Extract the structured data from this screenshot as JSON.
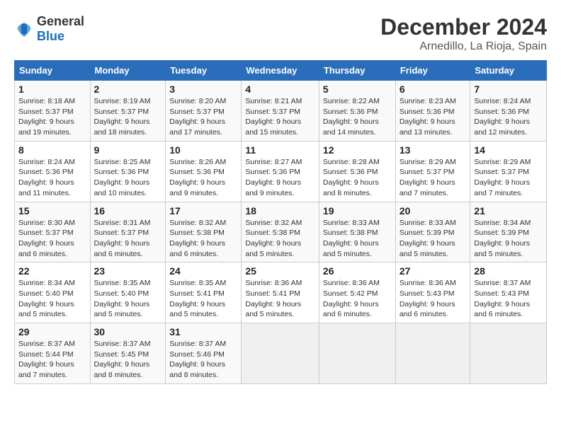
{
  "header": {
    "logo_general": "General",
    "logo_blue": "Blue",
    "month": "December 2024",
    "location": "Arnedillo, La Rioja, Spain"
  },
  "days_of_week": [
    "Sunday",
    "Monday",
    "Tuesday",
    "Wednesday",
    "Thursday",
    "Friday",
    "Saturday"
  ],
  "weeks": [
    [
      {
        "day": "1",
        "lines": [
          "Sunrise: 8:18 AM",
          "Sunset: 5:37 PM",
          "Daylight: 9 hours",
          "and 19 minutes."
        ]
      },
      {
        "day": "2",
        "lines": [
          "Sunrise: 8:19 AM",
          "Sunset: 5:37 PM",
          "Daylight: 9 hours",
          "and 18 minutes."
        ]
      },
      {
        "day": "3",
        "lines": [
          "Sunrise: 8:20 AM",
          "Sunset: 5:37 PM",
          "Daylight: 9 hours",
          "and 17 minutes."
        ]
      },
      {
        "day": "4",
        "lines": [
          "Sunrise: 8:21 AM",
          "Sunset: 5:37 PM",
          "Daylight: 9 hours",
          "and 15 minutes."
        ]
      },
      {
        "day": "5",
        "lines": [
          "Sunrise: 8:22 AM",
          "Sunset: 5:36 PM",
          "Daylight: 9 hours",
          "and 14 minutes."
        ]
      },
      {
        "day": "6",
        "lines": [
          "Sunrise: 8:23 AM",
          "Sunset: 5:36 PM",
          "Daylight: 9 hours",
          "and 13 minutes."
        ]
      },
      {
        "day": "7",
        "lines": [
          "Sunrise: 8:24 AM",
          "Sunset: 5:36 PM",
          "Daylight: 9 hours",
          "and 12 minutes."
        ]
      }
    ],
    [
      {
        "day": "8",
        "lines": [
          "Sunrise: 8:24 AM",
          "Sunset: 5:36 PM",
          "Daylight: 9 hours",
          "and 11 minutes."
        ]
      },
      {
        "day": "9",
        "lines": [
          "Sunrise: 8:25 AM",
          "Sunset: 5:36 PM",
          "Daylight: 9 hours",
          "and 10 minutes."
        ]
      },
      {
        "day": "10",
        "lines": [
          "Sunrise: 8:26 AM",
          "Sunset: 5:36 PM",
          "Daylight: 9 hours",
          "and 9 minutes."
        ]
      },
      {
        "day": "11",
        "lines": [
          "Sunrise: 8:27 AM",
          "Sunset: 5:36 PM",
          "Daylight: 9 hours",
          "and 9 minutes."
        ]
      },
      {
        "day": "12",
        "lines": [
          "Sunrise: 8:28 AM",
          "Sunset: 5:36 PM",
          "Daylight: 9 hours",
          "and 8 minutes."
        ]
      },
      {
        "day": "13",
        "lines": [
          "Sunrise: 8:29 AM",
          "Sunset: 5:37 PM",
          "Daylight: 9 hours",
          "and 7 minutes."
        ]
      },
      {
        "day": "14",
        "lines": [
          "Sunrise: 8:29 AM",
          "Sunset: 5:37 PM",
          "Daylight: 9 hours",
          "and 7 minutes."
        ]
      }
    ],
    [
      {
        "day": "15",
        "lines": [
          "Sunrise: 8:30 AM",
          "Sunset: 5:37 PM",
          "Daylight: 9 hours",
          "and 6 minutes."
        ]
      },
      {
        "day": "16",
        "lines": [
          "Sunrise: 8:31 AM",
          "Sunset: 5:37 PM",
          "Daylight: 9 hours",
          "and 6 minutes."
        ]
      },
      {
        "day": "17",
        "lines": [
          "Sunrise: 8:32 AM",
          "Sunset: 5:38 PM",
          "Daylight: 9 hours",
          "and 6 minutes."
        ]
      },
      {
        "day": "18",
        "lines": [
          "Sunrise: 8:32 AM",
          "Sunset: 5:38 PM",
          "Daylight: 9 hours",
          "and 5 minutes."
        ]
      },
      {
        "day": "19",
        "lines": [
          "Sunrise: 8:33 AM",
          "Sunset: 5:38 PM",
          "Daylight: 9 hours",
          "and 5 minutes."
        ]
      },
      {
        "day": "20",
        "lines": [
          "Sunrise: 8:33 AM",
          "Sunset: 5:39 PM",
          "Daylight: 9 hours",
          "and 5 minutes."
        ]
      },
      {
        "day": "21",
        "lines": [
          "Sunrise: 8:34 AM",
          "Sunset: 5:39 PM",
          "Daylight: 9 hours",
          "and 5 minutes."
        ]
      }
    ],
    [
      {
        "day": "22",
        "lines": [
          "Sunrise: 8:34 AM",
          "Sunset: 5:40 PM",
          "Daylight: 9 hours",
          "and 5 minutes."
        ]
      },
      {
        "day": "23",
        "lines": [
          "Sunrise: 8:35 AM",
          "Sunset: 5:40 PM",
          "Daylight: 9 hours",
          "and 5 minutes."
        ]
      },
      {
        "day": "24",
        "lines": [
          "Sunrise: 8:35 AM",
          "Sunset: 5:41 PM",
          "Daylight: 9 hours",
          "and 5 minutes."
        ]
      },
      {
        "day": "25",
        "lines": [
          "Sunrise: 8:36 AM",
          "Sunset: 5:41 PM",
          "Daylight: 9 hours",
          "and 5 minutes."
        ]
      },
      {
        "day": "26",
        "lines": [
          "Sunrise: 8:36 AM",
          "Sunset: 5:42 PM",
          "Daylight: 9 hours",
          "and 6 minutes."
        ]
      },
      {
        "day": "27",
        "lines": [
          "Sunrise: 8:36 AM",
          "Sunset: 5:43 PM",
          "Daylight: 9 hours",
          "and 6 minutes."
        ]
      },
      {
        "day": "28",
        "lines": [
          "Sunrise: 8:37 AM",
          "Sunset: 5:43 PM",
          "Daylight: 9 hours",
          "and 6 minutes."
        ]
      }
    ],
    [
      {
        "day": "29",
        "lines": [
          "Sunrise: 8:37 AM",
          "Sunset: 5:44 PM",
          "Daylight: 9 hours",
          "and 7 minutes."
        ]
      },
      {
        "day": "30",
        "lines": [
          "Sunrise: 8:37 AM",
          "Sunset: 5:45 PM",
          "Daylight: 9 hours",
          "and 8 minutes."
        ]
      },
      {
        "day": "31",
        "lines": [
          "Sunrise: 8:37 AM",
          "Sunset: 5:46 PM",
          "Daylight: 9 hours",
          "and 8 minutes."
        ]
      },
      null,
      null,
      null,
      null
    ]
  ]
}
